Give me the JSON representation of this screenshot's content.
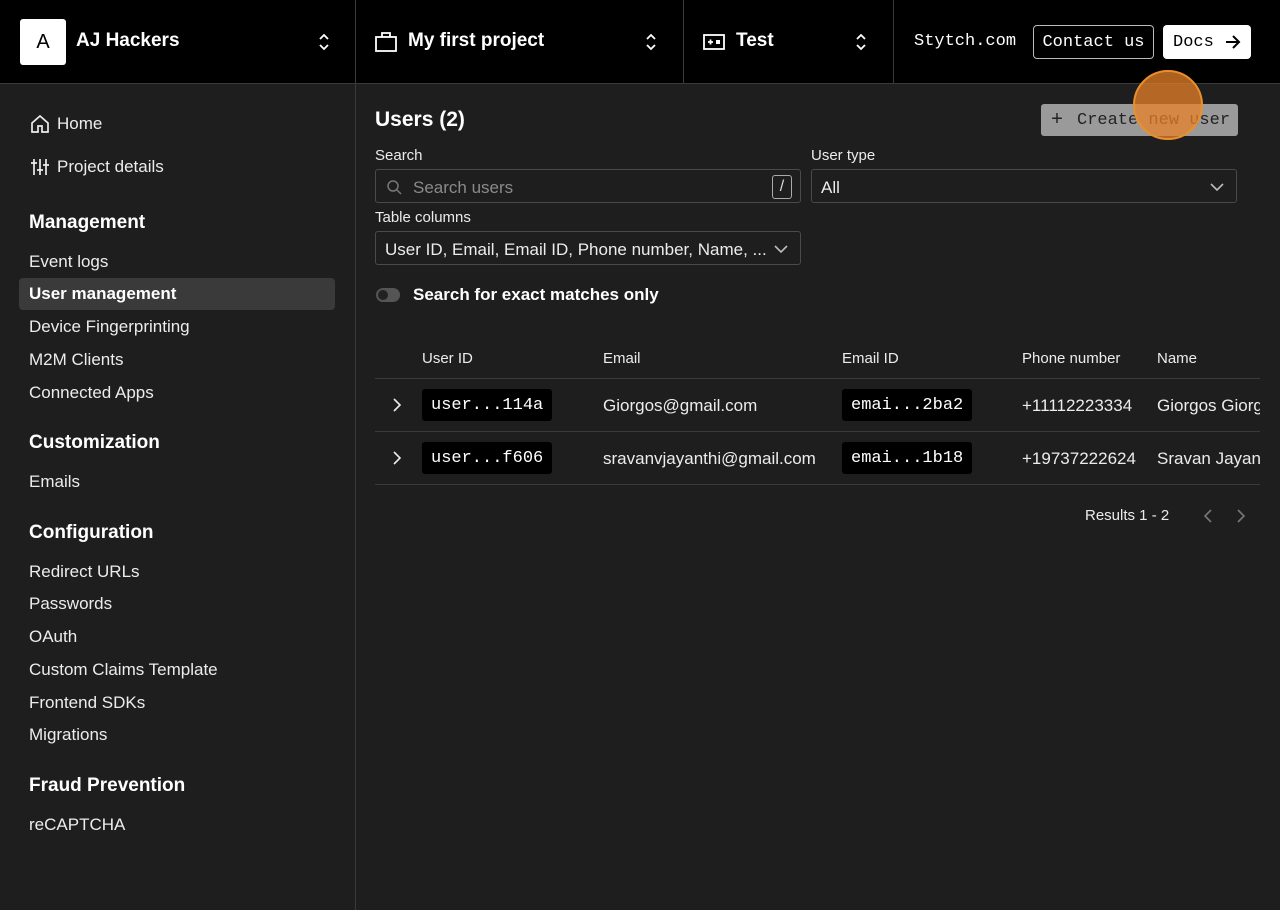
{
  "topbar": {
    "org_initial": "A",
    "org_name": "AJ Hackers",
    "project_name": "My first project",
    "environment": "Test",
    "site_link": "Stytch.com",
    "contact_label": "Contact us",
    "docs_label": "Docs"
  },
  "sidebar": {
    "top_items": [
      {
        "label": "Home",
        "icon": "home-icon"
      },
      {
        "label": "Project details",
        "icon": "sliders-icon"
      }
    ],
    "sections": [
      {
        "heading": "Management",
        "items": [
          "Event logs",
          "User management",
          "Device Fingerprinting",
          "M2M Clients",
          "Connected Apps"
        ]
      },
      {
        "heading": "Customization",
        "items": [
          "Emails"
        ]
      },
      {
        "heading": "Configuration",
        "items": [
          "Redirect URLs",
          "Passwords",
          "OAuth",
          "Custom Claims Template",
          "Frontend SDKs",
          "Migrations"
        ]
      },
      {
        "heading": "Fraud Prevention",
        "items": [
          "reCAPTCHA"
        ]
      }
    ],
    "active_item": "User management"
  },
  "main": {
    "title": "Users (2)",
    "create_label": "Create new user",
    "search": {
      "label": "Search",
      "placeholder": "Search users",
      "shortcut": "/"
    },
    "user_type": {
      "label": "User type",
      "value": "All"
    },
    "table_columns": {
      "label": "Table columns",
      "value": "User ID, Email, Email ID, Phone number, Name, ..."
    },
    "exact_match": {
      "label": "Search for exact matches only",
      "enabled": false
    },
    "table": {
      "headers": [
        "User ID",
        "Email",
        "Email ID",
        "Phone number",
        "Name"
      ],
      "rows": [
        {
          "user_id": "user...114a",
          "email": "Giorgos@gmail.com",
          "email_id": "emai...2ba2",
          "phone": "+11112223334",
          "name": "Giorgos Giorg"
        },
        {
          "user_id": "user...f606",
          "email": "sravanvjayanthi@gmail.com",
          "email_id": "emai...1b18",
          "phone": "+19737222624",
          "name": "Sravan Jayan"
        }
      ]
    },
    "results_text": "Results 1 - 2"
  },
  "colors": {
    "background": "#1e1e1e",
    "topbar": "#000000",
    "active_item": "#3a3a3a",
    "click_marker": "#e8902e"
  }
}
